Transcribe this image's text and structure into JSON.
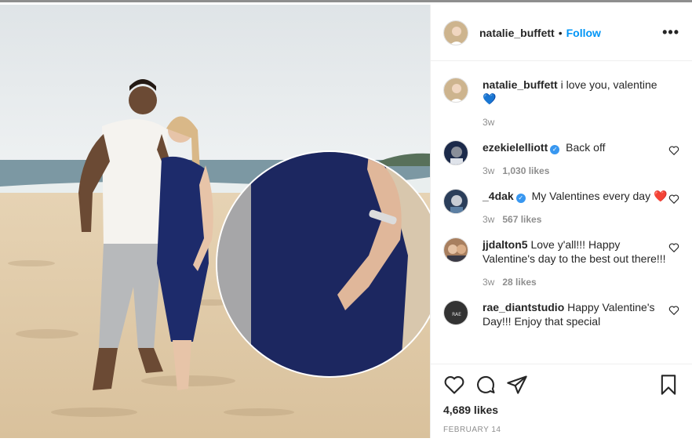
{
  "header": {
    "username": "natalie_buffett",
    "separator": "•",
    "follow_label": "Follow",
    "more_label": "•••"
  },
  "comments": [
    {
      "user": "natalie_buffett",
      "text": "i love you, valentine 💙",
      "time": "3w",
      "likes": "",
      "verified": false,
      "avatar_color": "#c9b79a"
    },
    {
      "user": "ezekielelliott",
      "text": "Back off",
      "time": "3w",
      "likes": "1,030 likes",
      "verified": true,
      "avatar_color": "#1c2a4a"
    },
    {
      "user": "_4dak",
      "text": "My Valentines every day ❤️",
      "time": "3w",
      "likes": "567 likes",
      "verified": true,
      "avatar_color": "#2b3e5a"
    },
    {
      "user": "jjdalton5",
      "text": "Love y'all!!! Happy Valentine's day to the best out there!!!",
      "time": "3w",
      "likes": "28 likes",
      "verified": false,
      "avatar_color": "#a87f5f"
    },
    {
      "user": "rae_diantstudio",
      "text": "Happy Valentine's Day!!! Enjoy that special",
      "time": "",
      "likes": "",
      "verified": false,
      "avatar_color": "#333333"
    }
  ],
  "actions": {
    "like_count": "4,689 likes",
    "date": "FEBRUARY 14"
  },
  "icons": [
    "heart-icon",
    "comment-icon",
    "share-icon",
    "bookmark-icon"
  ],
  "colors": {
    "follow": "#0095f6",
    "verified": "#3897f0",
    "muted": "#8e8e8e"
  }
}
